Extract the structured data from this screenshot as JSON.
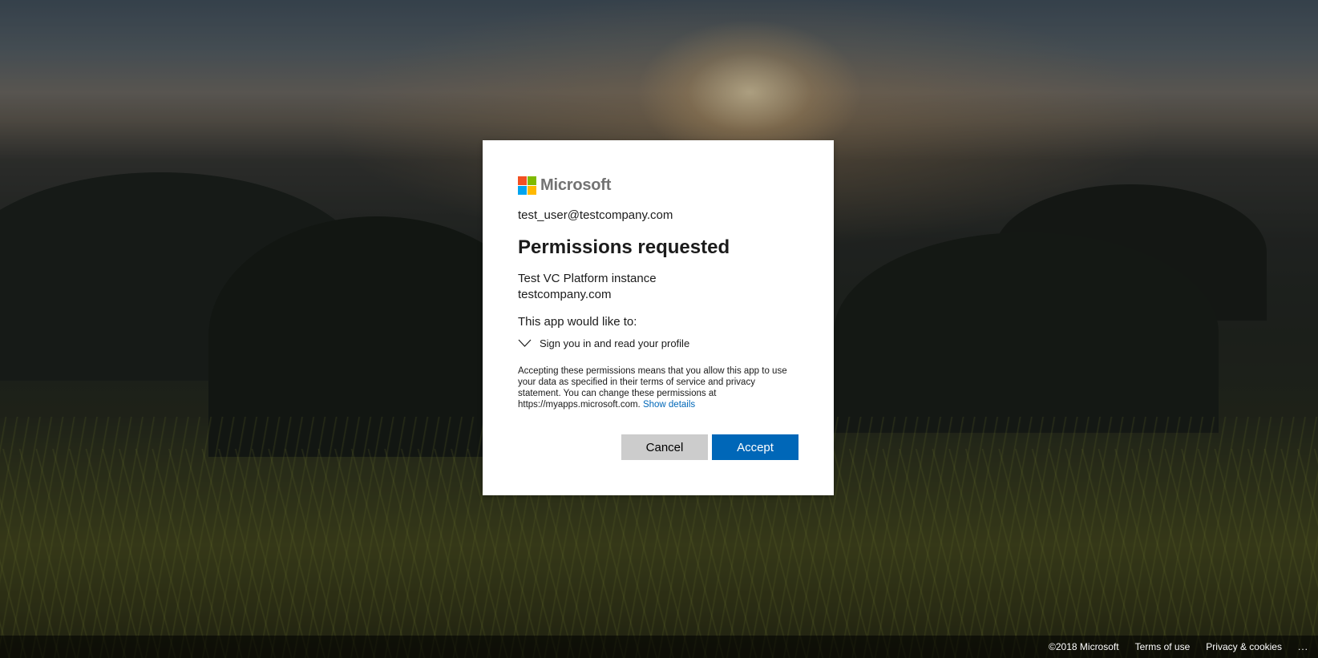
{
  "brand": {
    "name": "Microsoft",
    "colors": [
      "#f25022",
      "#7fba00",
      "#00a4ef",
      "#ffb900"
    ]
  },
  "dialog": {
    "account": "test_user@testcompany.com",
    "title": "Permissions requested",
    "app_name": "Test VC Platform instance",
    "app_domain": "testcompany.com",
    "would_like": "This app would like to:",
    "permission": "Sign you in and read your profile",
    "disclaimer": "Accepting these permissions means that you allow this app to use your data as specified in their terms of service and privacy statement. You can change these permissions at https://myapps.microsoft.com.",
    "show_details": "Show details",
    "cancel_label": "Cancel",
    "accept_label": "Accept",
    "accent_color": "#0067b8"
  },
  "footer": {
    "copyright": "©2018 Microsoft",
    "terms": "Terms of use",
    "privacy": "Privacy & cookies",
    "more": "..."
  }
}
